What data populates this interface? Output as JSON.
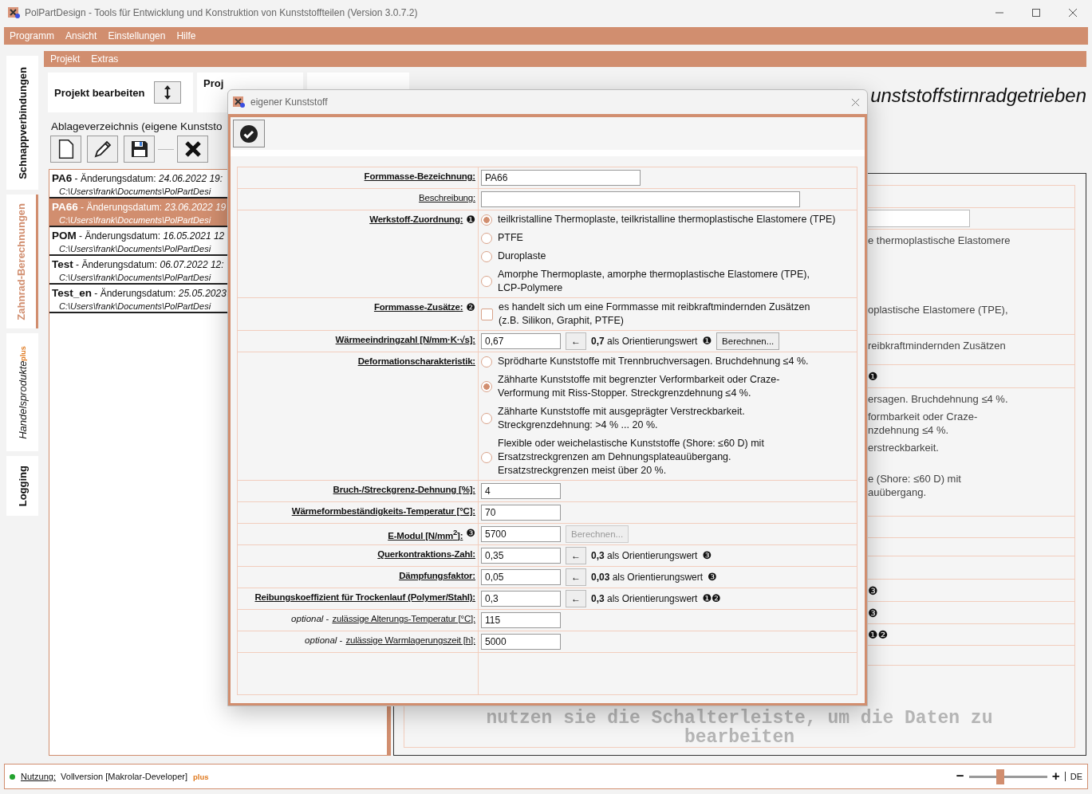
{
  "window": {
    "title": "PolPartDesign - Tools für Entwicklung und Konstruktion von Kunststoffteilen (Version 3.0.7.2)"
  },
  "menu": [
    "Programm",
    "Ansicht",
    "Einstellungen",
    "Hilfe"
  ],
  "side_tabs": [
    {
      "label": "Schnappverbindungen",
      "selected": false
    },
    {
      "label": "Zahnrad-Berechnungen",
      "selected": true
    },
    {
      "label": "Handelsprodukte",
      "badge": "plus",
      "selected": false
    },
    {
      "label": "Logging",
      "selected": false
    }
  ],
  "submenu": [
    "Projekt",
    "Extras"
  ],
  "project_tabs": [
    {
      "label": "Projekt bearbeiten"
    },
    {
      "label": "Proj"
    }
  ],
  "heading": "unststoffstirnradgetrieben",
  "storage": {
    "title": "Ablageverzeichnis (eigene Kunststo",
    "items": [
      {
        "line": "**PA6** - Änderungsdatum: *24.06.2022 19:*",
        "path": "C:\\Users\\frank\\Documents\\PolPartDesi",
        "selected": false
      },
      {
        "line": "**PA66** - Änderungsdatum: *23.06.2022 19*",
        "path": "C:\\Users\\frank\\Documents\\PolPartDesi",
        "selected": true
      },
      {
        "line": "**POM** - Änderungsdatum: *16.05.2021 12*",
        "path": "C:\\Users\\frank\\Documents\\PolPartDesi",
        "selected": false
      },
      {
        "line": "**Test** - Änderungsdatum: *06.07.2022 12:*",
        "path": "C:\\Users\\frank\\Documents\\PolPartDesi",
        "selected": false
      },
      {
        "line": "**Test_en** - Änderungsdatum: *25.05.2023*",
        "path": "C:\\Users\\frank\\Documents\\PolPartDesi",
        "selected": false
      }
    ]
  },
  "background_form": {
    "rows": [
      {
        "kind": "blank"
      },
      {
        "kind": "field"
      },
      {
        "kind": "text",
        "groups": [
          [
            "e thermoplastische Elastomere"
          ],
          [
            "oplastische Elastomere (TPE),"
          ]
        ]
      },
      {
        "kind": "text",
        "groups": [
          [
            "reibkraftmindernden Zusätzen"
          ]
        ]
      },
      {
        "kind": "note",
        "note": "❶"
      },
      {
        "kind": "text",
        "groups": [
          [
            "ersagen. Bruchdehnung ≤4 %."
          ],
          [
            "formbarkeit oder Craze-",
            "nzdehnung ≤4 %."
          ],
          [
            "erstreckbarkeit."
          ],
          [
            "e (Shore: ≤60 D) mit",
            "auübergang."
          ]
        ]
      },
      {
        "kind": "blank"
      },
      {
        "kind": "blank"
      },
      {
        "kind": "blank"
      },
      {
        "kind": "note",
        "note": "❸"
      },
      {
        "kind": "note",
        "note": "❸"
      },
      {
        "kind": "note",
        "note": "❶❷"
      },
      {
        "kind": "blank"
      }
    ],
    "message": "nutzen sie die Schalterleiste, um die Daten zu bearbeiten"
  },
  "dialog": {
    "title": "eigener Kunststoff",
    "rows": [
      {
        "kind": "input",
        "label": "Formmasse-Bezeichnung:",
        "bold": true,
        "value": "PA66"
      },
      {
        "kind": "input",
        "label": "Beschreibung:",
        "bold": false
      },
      {
        "kind": "radio",
        "label": "Werkstoff-Zuordnung:",
        "bold": true,
        "note": "❶",
        "options": [
          {
            "label": "teilkristalline Thermoplaste, teilkristalline thermoplastische Elastomere (TPE)",
            "selected": true
          },
          {
            "label": "PTFE",
            "selected": false
          },
          {
            "label": "Duroplaste",
            "selected": false
          },
          {
            "label": "Amorphe Thermoplaste, amorphe thermoplastische Elastomere (TPE),\nLCP-Polymere",
            "selected": false
          }
        ]
      },
      {
        "kind": "checkbox",
        "label": "Formmasse-Zusätze:",
        "bold": true,
        "note": "❷",
        "checked": false,
        "text": "es handelt sich um eine Formmasse mit reibkraftmindernden Zusätzen\n(z.B. Silikon, Graphit, PTFE)"
      },
      {
        "kind": "input",
        "label": "Wärmeeindringzahl [N/mm·K·√s]:",
        "bold": true,
        "value": "0,67",
        "apply": "←",
        "hint": "**0,7** als Orientierungswert",
        "hint_note": "❶",
        "calc": {
          "label": "Berechnen...",
          "disabled": false
        }
      },
      {
        "kind": "radio",
        "label": "Deformationscharakteristik:",
        "bold": true,
        "options": [
          {
            "label": "Sprödharte Kunststoffe mit Trennbruchversagen. Bruchdehnung ≤4 %.",
            "selected": false
          },
          {
            "label": "Zähharte Kunststoffe mit begrenzter Verformbarkeit oder Craze-\nVerformung mit Riss-Stopper. Streckgrenzdehnung ≤4 %.",
            "selected": true
          },
          {
            "label": "Zähharte Kunststoffe mit ausgeprägter Verstreckbarkeit.\nStreckgrenzdehnung: >4 % ... 20 %.",
            "selected": false
          },
          {
            "label": "Flexible oder weichelastische Kunststoffe (Shore: ≤60 D) mit\nErsatzstreckgrenzen am Dehnungsplateauübergang.\nErsatzstreckgrenzen meist über 20 %.",
            "selected": false
          }
        ]
      },
      {
        "kind": "input",
        "label": "Bruch-/Streckgrenz-Dehnung [%]:",
        "bold": true,
        "value": "4"
      },
      {
        "kind": "input",
        "label": "Wärmeformbeständigkeits-Temperatur [°C]:",
        "bold": true,
        "value": "70"
      },
      {
        "kind": "input",
        "label": "E-Modul [N/mm$^{2}$]:",
        "bold": true,
        "note": "❸",
        "value": "5700",
        "calc": {
          "label": "Berechnen...",
          "disabled": true
        }
      },
      {
        "kind": "input",
        "label": "Querkontraktions-Zahl:",
        "bold": true,
        "value": "0,35",
        "apply": "←",
        "hint": "**0,3** als Orientierungswert",
        "hint_note": "❸"
      },
      {
        "kind": "input",
        "label": "Dämpfungsfaktor:",
        "bold": true,
        "value": "0,05",
        "apply": "←",
        "hint": "**0,03** als Orientierungswert",
        "hint_note": "❸"
      },
      {
        "kind": "input",
        "label": "Reibungskoeffizient für Trockenlauf (Polymer/Stahl):",
        "bold": true,
        "value": "0,3",
        "apply": "←",
        "hint": "**0,3** als Orientierungswert",
        "hint_note": "❶❷"
      },
      {
        "kind": "input",
        "prefix": "*optional* -",
        "label": "zulässige Alterungs-Temperatur [°C]:",
        "bold": false,
        "value": "115"
      },
      {
        "kind": "input",
        "prefix": "*optional* -",
        "label": "zulässige Warmlagerungszeit [h]:",
        "bold": false,
        "value": "5000"
      }
    ]
  },
  "status_bar": {
    "label": "Nutzung:",
    "value": "Vollversion [Makrolar-Developer]",
    "badge": "plus",
    "zoom": {
      "minus": "−",
      "plus": "+",
      "level": 0.4
    },
    "language": "DE"
  }
}
